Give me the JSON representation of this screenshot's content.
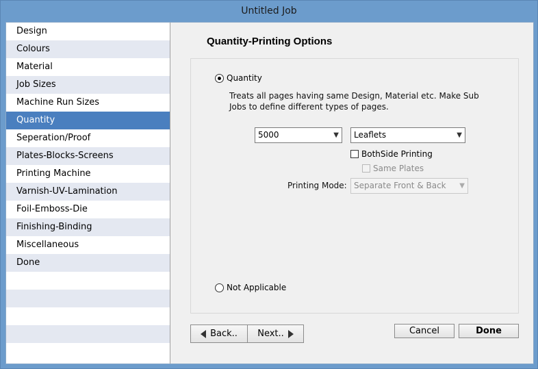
{
  "window": {
    "title": "Untitled Job"
  },
  "sidebar": {
    "items": [
      {
        "label": "Design"
      },
      {
        "label": "Colours"
      },
      {
        "label": "Material"
      },
      {
        "label": "Job Sizes"
      },
      {
        "label": "Machine Run Sizes"
      },
      {
        "label": "Quantity",
        "selected": true
      },
      {
        "label": "Seperation/Proof"
      },
      {
        "label": "Plates-Blocks-Screens"
      },
      {
        "label": "Printing Machine"
      },
      {
        "label": "Varnish-UV-Lamination"
      },
      {
        "label": "Foil-Emboss-Die"
      },
      {
        "label": "Finishing-Binding"
      },
      {
        "label": "Miscellaneous"
      },
      {
        "label": "Done"
      }
    ]
  },
  "main": {
    "heading": "Quantity-Printing Options",
    "quantity_radio": {
      "label": "Quantity",
      "checked": true
    },
    "description": "Treats all pages having same Design, Material etc. Make Sub Jobs to define different types of pages.",
    "quantity_select": {
      "value": "5000"
    },
    "type_select": {
      "value": "Leaflets"
    },
    "bothside_check": {
      "label": "BothSide Printing",
      "checked": false
    },
    "sameplates_check": {
      "label": "Same Plates",
      "checked": false,
      "disabled": true
    },
    "printing_mode": {
      "label": "Printing Mode:",
      "value": "Separate Front & Back",
      "disabled": true
    },
    "not_applicable_radio": {
      "label": "Not Applicable",
      "checked": false
    }
  },
  "buttons": {
    "back": "Back..",
    "next": "Next..",
    "cancel": "Cancel",
    "done": "Done"
  }
}
